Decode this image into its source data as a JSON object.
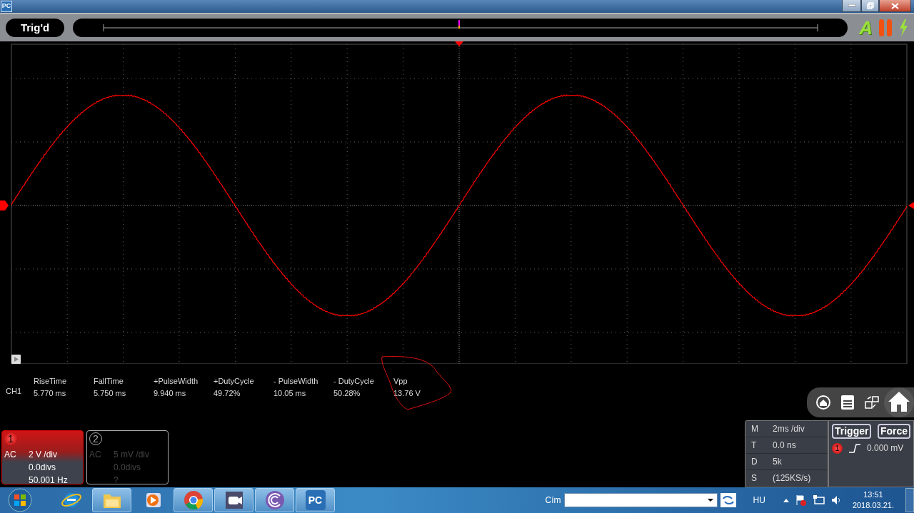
{
  "window": {
    "app_badge": "PC"
  },
  "toolbar": {
    "status": "Trig'd",
    "mode": "A"
  },
  "measurements": {
    "channel": "CH1",
    "items": [
      {
        "label": "RiseTime",
        "value": "5.770 ms"
      },
      {
        "label": "FallTime",
        "value": "5.750 ms"
      },
      {
        "label": "+PulseWidth",
        "value": "9.940 ms"
      },
      {
        "label": "+DutyCycle",
        "value": "49.72%"
      },
      {
        "label": "- PulseWidth",
        "value": "10.05 ms"
      },
      {
        "label": "- DutyCycle",
        "value": "50.28%"
      },
      {
        "label": "Vpp",
        "value": "13.76 V",
        "circled": true
      }
    ]
  },
  "channels": [
    {
      "number": "1",
      "coupling": "AC",
      "scale": "2 V /div",
      "offset": "0.0divs",
      "reading": "50.001 Hz",
      "selected": true
    },
    {
      "number": "2",
      "coupling": "AC",
      "scale": "5 mV /div",
      "offset": "0.0divs",
      "reading": "?",
      "selected": false
    }
  ],
  "timebase": [
    {
      "key": "M",
      "value": "2ms /div"
    },
    {
      "key": "T",
      "value": "0.0 ns"
    },
    {
      "key": "D",
      "value": "5k"
    },
    {
      "key": "S",
      "value": "(125KS/s)"
    }
  ],
  "trigger": {
    "buttons": [
      "Trigger",
      "Force"
    ],
    "channel": "1",
    "level": "0.000 mV"
  },
  "taskbar": {
    "apps": [
      {
        "kind": "ie",
        "running": false
      },
      {
        "kind": "folder",
        "running": true
      },
      {
        "kind": "media",
        "running": false
      },
      {
        "kind": "chrome",
        "running": true
      },
      {
        "kind": "camera",
        "running": true
      },
      {
        "kind": "spiral",
        "running": true
      },
      {
        "kind": "pc",
        "running": true,
        "text": "PC"
      }
    ],
    "address_label": "Cím",
    "language": "HU",
    "time": "13:51",
    "date": "2018.03.21."
  }
}
